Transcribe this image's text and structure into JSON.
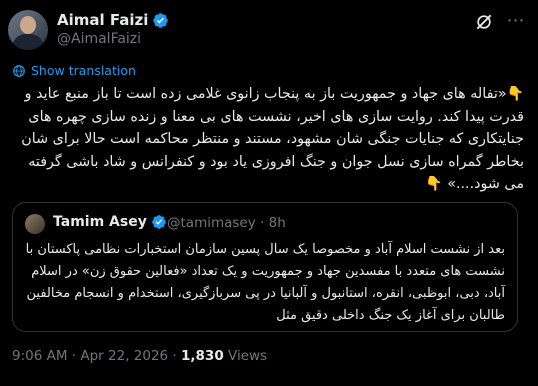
{
  "author": {
    "name": "Aimal Faizi",
    "handle": "@AimalFaizi"
  },
  "translate_label": "Show translation",
  "tweet": {
    "emoji_start": "👇",
    "text": "«تفاله های جهاد و جمهوریت باز به پنجاب زانوی غلامی زده است تا باز منبع عاید و قدرت پیدا کند. روایت سازی های اخیر، نشست های بی معنا و زنده سازی چهره های جنایتکاری که جنایات جنگی شان مشهود، مستند و منتظر محاکمه است حالا برای شان بخاطر گمراه سازی نسل جوان و جنگ افروزی یاد بود و کنفرانس و شاد باشی گرفته می شود....»",
    "emoji_end": "👇"
  },
  "quoted": {
    "name": "Tamim Asey",
    "handle": "@tamimasey",
    "time": "· 8h",
    "text": "بعد از نشست اسلام آباد و مخصوصا یک سال پسین سازمان استخبارات نظامی پاکستان با نشست های متعدد با مفسدین جهاد و جمهوریت و یک تعداد «فعالین حقوق زن» در اسلام آباد، دبی، ابوظبی، انقره، استانبول و آلبانیا در پی سربازگیری، استخدام و انسجام مخالفین طالبان برای آغاز یک جنگ داخلی دقیق مثل"
  },
  "footer": {
    "timestamp": "9:06 AM · Apr 22, 2026 · ",
    "views_count": "1,830",
    "views_label": "Views"
  },
  "colors": {
    "background": "#000000",
    "text": "#e7e9ea",
    "muted": "#71767b",
    "accent": "#1d9bf0",
    "border": "#2f3336"
  }
}
